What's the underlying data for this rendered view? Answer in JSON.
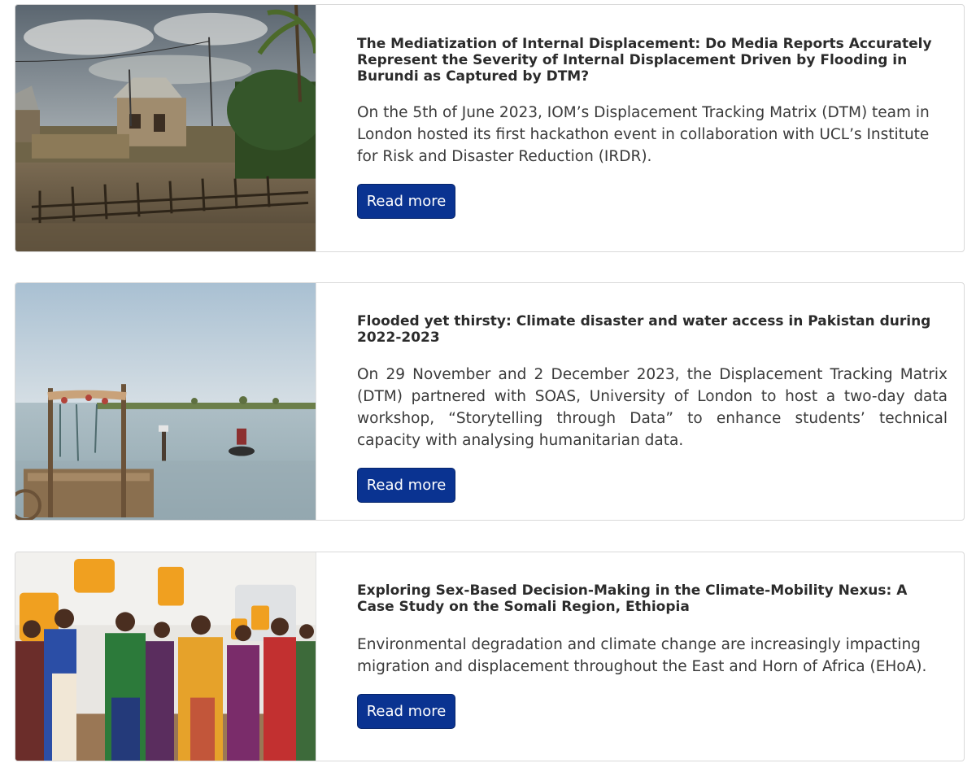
{
  "articles": [
    {
      "title": "The Mediatization of Internal Displacement: Do Media Reports Accurately Represent the Severity of Internal Displacement Driven by Flooding in Burundi as Captured by DTM?",
      "summary": "On the 5th of June 2023, IOM’s Displacement Tracking Matrix (DTM) team in London hosted its first hackathon event in collaboration with UCL’s Institute for Risk and Disaster Reduction (IRDR).",
      "button_label": "Read more"
    },
    {
      "title": "Flooded yet thirsty: Climate disaster and water access in Pakistan during 2022-2023",
      "summary": "On 29 November and 2 December 2023, the Displacement Tracking Matrix (DTM) partnered with SOAS, University of London to host a two-day data workshop, “Storytelling through Data” to enhance students’ technical capacity with analysing humanitarian data.",
      "button_label": "Read more"
    },
    {
      "title": "Exploring Sex-Based Decision-Making in the Climate-Mobility Nexus: A Case Study on the Somali Region, Ethiopia",
      "summary": "Environmental degradation and climate change are increasingly impacting migration and displacement throughout the East and Horn of Africa (EHoA).",
      "button_label": "Read more"
    }
  ],
  "colors": {
    "button_bg": "#0a3391",
    "button_text": "#ffffff",
    "card_border": "#d9d9d9",
    "title_text": "#2b2b2b"
  }
}
